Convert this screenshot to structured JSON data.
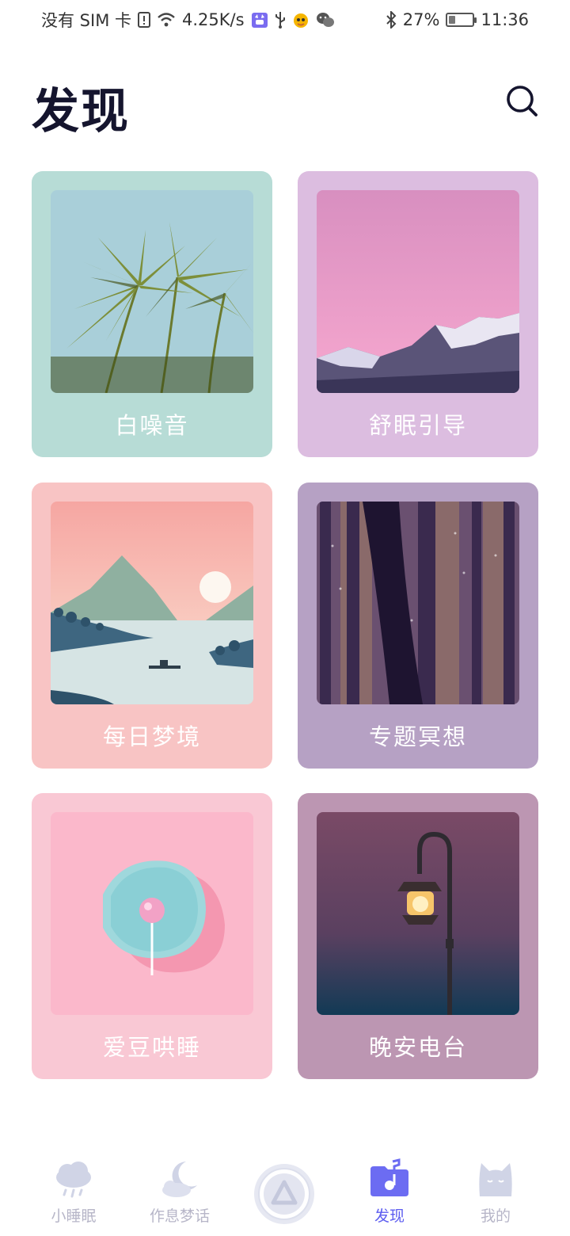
{
  "status_bar": {
    "carrier": "没有 SIM 卡",
    "network_speed": "4.25K/s",
    "battery_percent": "27%",
    "battery_level": 0.27,
    "time": "11:36"
  },
  "header": {
    "title": "发现",
    "search_icon": "search-icon"
  },
  "cards": [
    {
      "label": "白噪音",
      "color": "#b7dcd6",
      "image": "palm-trees"
    },
    {
      "label": "舒眠引导",
      "color": "#dcbde0",
      "image": "pink-mountain-moon"
    },
    {
      "label": "每日梦境",
      "color": "#f8c4c4",
      "image": "lake-landscape"
    },
    {
      "label": "专题冥想",
      "color": "#b6a1c4",
      "image": "dark-forest"
    },
    {
      "label": "爱豆哄睡",
      "color": "#f9c8d4",
      "image": "lollipop-dish"
    },
    {
      "label": "晚安电台",
      "color": "#bc96b2",
      "image": "street-lamp"
    }
  ],
  "bottom_nav": {
    "items": [
      {
        "label": "小睡眠",
        "icon": "rain-cloud-icon",
        "active": false
      },
      {
        "label": "作息梦话",
        "icon": "moon-cloud-icon",
        "active": false
      },
      {
        "label": "发现",
        "icon": "music-folder-icon",
        "active": true
      },
      {
        "label": "我的",
        "icon": "cat-icon",
        "active": false
      }
    ],
    "center_icon": "play-triangle-icon",
    "active_color": "#5c5cf0",
    "inactive_color": "#b7b6c8"
  }
}
